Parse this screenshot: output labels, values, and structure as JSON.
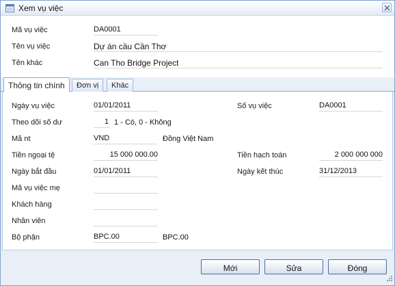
{
  "window": {
    "title": "Xem vụ việc"
  },
  "header": {
    "code_label": "Mã vụ việc",
    "code_value": "DA0001",
    "name_label": "Tên vụ việc",
    "name_value": "Dự án cầu Cần Thơ",
    "other_label": "Tên khác",
    "other_value": "Can Tho Bridge Project"
  },
  "tabs": [
    {
      "label": "Thông tin chính",
      "active": true
    },
    {
      "label": "Đơn vị",
      "active": false
    },
    {
      "label": "Khác",
      "active": false
    }
  ],
  "main": {
    "date_label": "Ngày vụ việc",
    "date_value": "01/01/2011",
    "number_label": "Số vụ việc",
    "number_value": "DA0001",
    "track_label": "Theo dõi số dư",
    "track_value": "1",
    "track_hint": "1 - Có, 0 - Không",
    "currency_label": "Mã nt",
    "currency_value": "VND",
    "currency_name": "Đồng Việt Nam",
    "foreign_amount_label": "Tiền ngoại tệ",
    "foreign_amount_value": "15 000 000.00",
    "accounting_amount_label": "Tiền hạch toán",
    "accounting_amount_value": "2 000 000 000",
    "start_label": "Ngày bắt đầu",
    "start_value": "01/01/2011",
    "end_label": "Ngày kết thúc",
    "end_value": "31/12/2013",
    "parent_label": "Mã vụ việc mẹ",
    "parent_value": "",
    "customer_label": "Khách hàng",
    "customer_value": "",
    "employee_label": "Nhân viên",
    "employee_value": "",
    "department_label": "Bộ phận",
    "department_value": "BPC.00",
    "department_name": "BPC.00"
  },
  "buttons": {
    "new_label": "Mới",
    "edit_label": "Sửa",
    "close_label": "Đóng"
  },
  "icons": {
    "window": "form-icon",
    "close": "close-icon",
    "resize": "resize-grip-icon"
  },
  "colors": {
    "accent_border": "#7da2ce",
    "button_border": "#4e6d99"
  }
}
